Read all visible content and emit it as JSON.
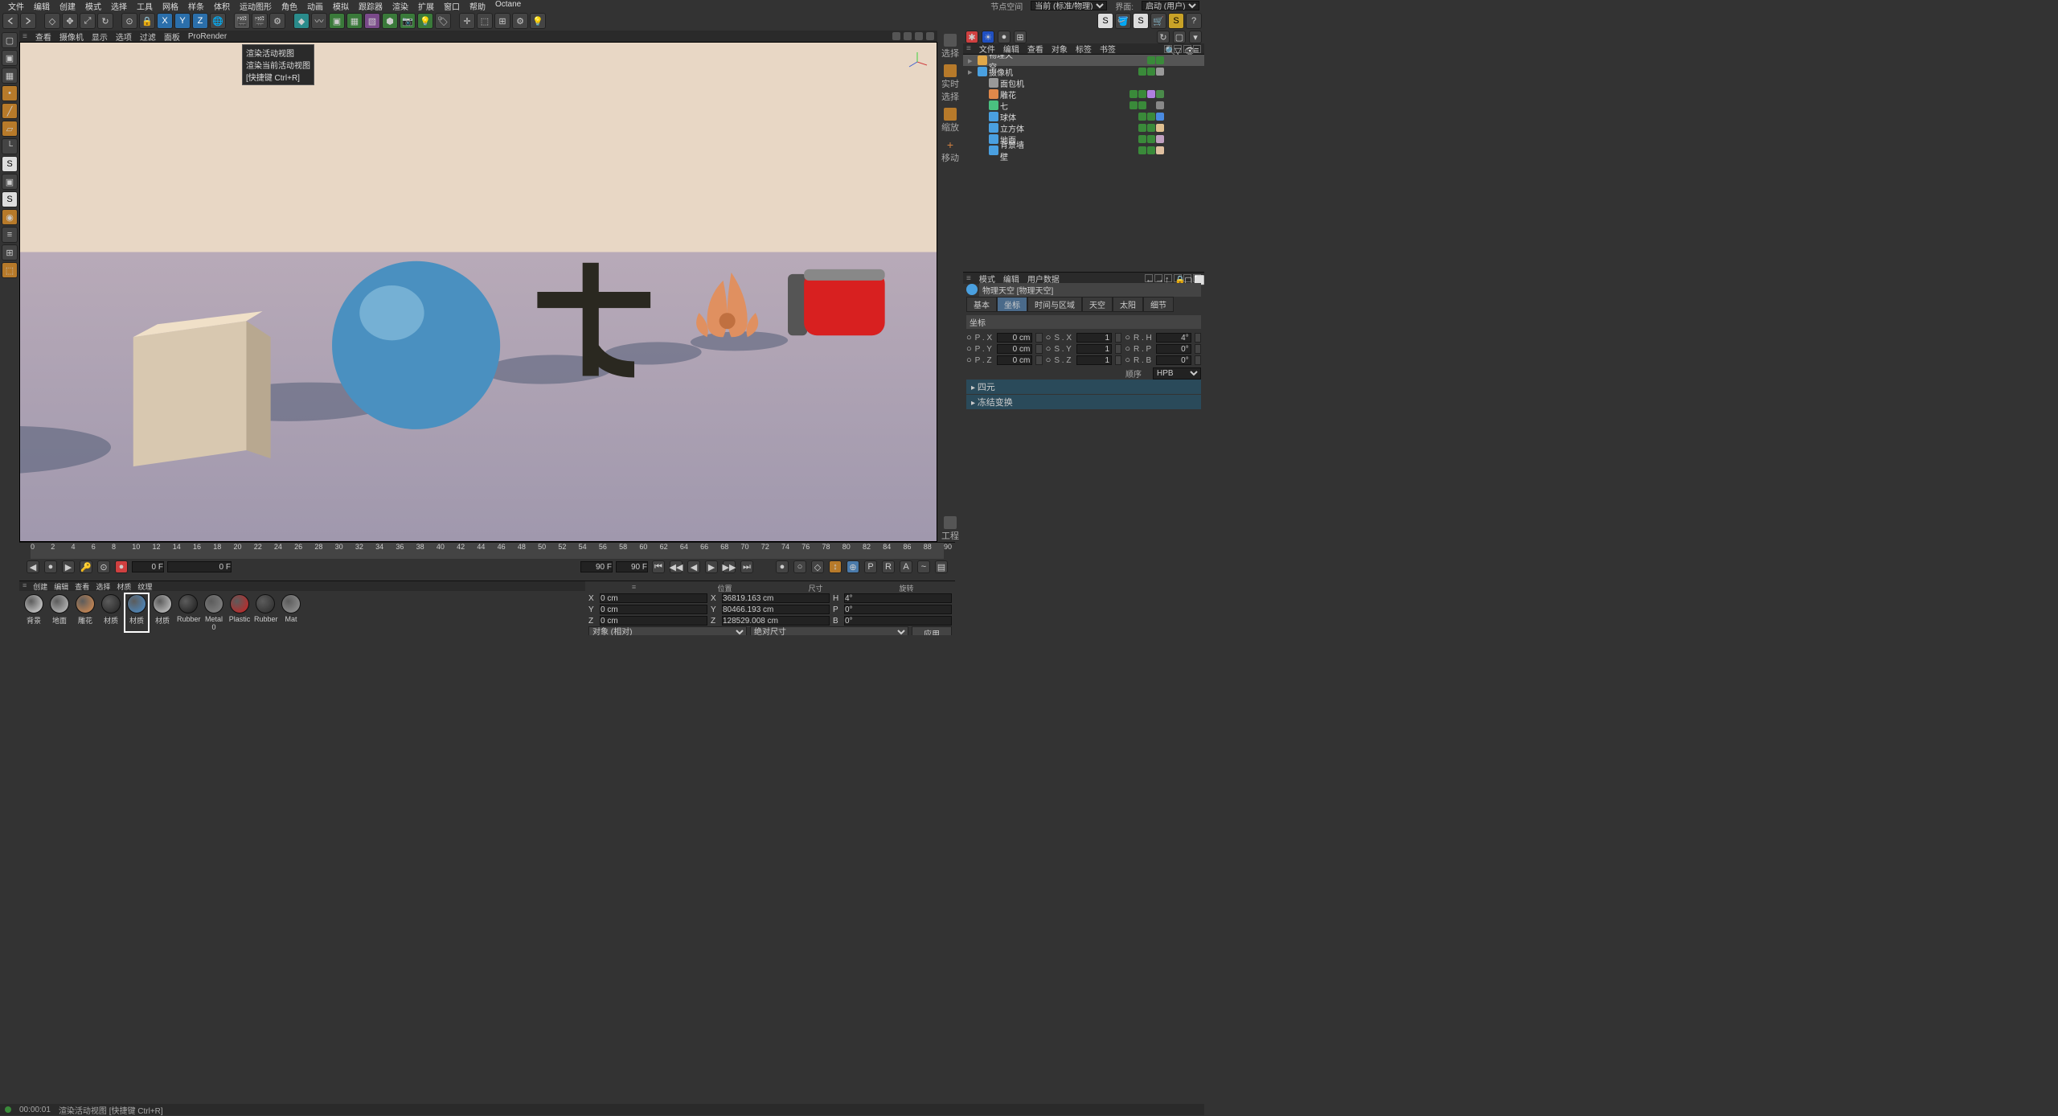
{
  "menu": {
    "items": [
      "文件",
      "编辑",
      "创建",
      "模式",
      "选择",
      "工具",
      "网格",
      "样条",
      "体积",
      "运动图形",
      "角色",
      "动画",
      "模拟",
      "跟踪器",
      "渲染",
      "扩展",
      "窗口",
      "帮助",
      "Octane"
    ],
    "right": {
      "pivot": "节点空间",
      "layout_label": "当前 (标准/物理)",
      "workspace_label": "界面:",
      "workspace": "启动 (用户)"
    }
  },
  "vp_menu": [
    "查看",
    "摄像机",
    "显示",
    "选项",
    "过滤",
    "面板",
    "ProRender"
  ],
  "tooltip": {
    "title": "渲染活动视图",
    "desc": "渲染当前活动视图",
    "shortcut": "[快捷键 Ctrl+R]"
  },
  "palette": [
    {
      "label": "选择"
    },
    {
      "label": "实时选择"
    },
    {
      "label": "缩放"
    },
    {
      "label": "移动"
    },
    {
      "label": ""
    },
    {
      "label": ""
    },
    {
      "label": "工程"
    }
  ],
  "obj_panel_tabs": [
    "文件",
    "编辑",
    "查看",
    "对象",
    "标签",
    "书签"
  ],
  "objects": [
    {
      "name": "物理天空",
      "indent": 0,
      "color": "#e0a84a",
      "sel": true,
      "tags": [
        "#3a8a3a",
        "#3a8a3a"
      ]
    },
    {
      "name": "摄像机",
      "indent": 0,
      "color": "#4aa0e0",
      "tags": [
        "#3a8a3a",
        "#3a8a3a",
        "#999"
      ]
    },
    {
      "name": "面包机",
      "indent": 1,
      "color": "#999",
      "tags": []
    },
    {
      "name": "雕花",
      "indent": 1,
      "color": "#e0884a",
      "tags": [
        "#3a8a3a",
        "#3a8a3a",
        "#b080e0",
        "#4a8a4a"
      ]
    },
    {
      "name": "七",
      "indent": 1,
      "color": "#4ac080",
      "tags": [
        "#3a8a3a",
        "#3a8a3a",
        "#333",
        "#888"
      ]
    },
    {
      "name": "球体",
      "indent": 1,
      "color": "#4aa0e0",
      "tags": [
        "#3a8a3a",
        "#3a8a3a",
        "#4a8ae0"
      ]
    },
    {
      "name": "立方体",
      "indent": 1,
      "color": "#4aa0e0",
      "tags": [
        "#3a8a3a",
        "#3a8a3a",
        "#e0c090"
      ]
    },
    {
      "name": "地面",
      "indent": 1,
      "color": "#4aa0e0",
      "tags": [
        "#3a8a3a",
        "#3a8a3a",
        "#c0a0c0"
      ]
    },
    {
      "name": "背景墙壁",
      "indent": 1,
      "color": "#4aa0e0",
      "tags": [
        "#3a8a3a",
        "#3a8a3a",
        "#e0c0a0"
      ]
    }
  ],
  "attr": {
    "header": [
      "模式",
      "编辑",
      "用户数据"
    ],
    "title": "物理天空 [物理天空]",
    "tabs": [
      "基本",
      "坐标",
      "时间与区域",
      "天空",
      "太阳",
      "细节"
    ],
    "active_tab": 1,
    "section": "坐标",
    "rows": [
      {
        "pl": "P . X",
        "pv": "0 cm",
        "sl": "S . X",
        "sv": "1",
        "rl": "R . H",
        "rv": "4°"
      },
      {
        "pl": "P . Y",
        "pv": "0 cm",
        "sl": "S . Y",
        "sv": "1",
        "rl": "R . P",
        "rv": "0°"
      },
      {
        "pl": "P . Z",
        "pv": "0 cm",
        "sl": "S . Z",
        "sv": "1",
        "rl": "R . B",
        "rv": "0°"
      }
    ],
    "order_label": "顺序",
    "order": "HPB",
    "sections": [
      "四元",
      "冻结变换"
    ]
  },
  "timeline": {
    "ticks": [
      0,
      2,
      4,
      6,
      8,
      10,
      12,
      14,
      16,
      18,
      20,
      22,
      24,
      26,
      28,
      30,
      32,
      34,
      36,
      38,
      40,
      42,
      44,
      46,
      48,
      50,
      52,
      54,
      56,
      58,
      60,
      62,
      64,
      66,
      68,
      70,
      72,
      74,
      76,
      78,
      80,
      82,
      84,
      86,
      88,
      90
    ],
    "cur": "0 F",
    "start": "0 F",
    "end1": "90 F",
    "end2": "90 F",
    "label_end": "0 F"
  },
  "mat_tabs": [
    "创建",
    "编辑",
    "查看",
    "选择",
    "材质",
    "纹理"
  ],
  "materials": [
    {
      "name": "背景",
      "color": "#e0e0e0"
    },
    {
      "name": "地面",
      "color": "#c8c8c8"
    },
    {
      "name": "雕花",
      "color": "#e09050"
    },
    {
      "name": "材质",
      "color": "#222"
    },
    {
      "name": "材质",
      "color": "#4a90d0",
      "sel": true
    },
    {
      "name": "材质",
      "color": "#d0d0d0"
    },
    {
      "name": "Rubber",
      "color": "#1a1a1a"
    },
    {
      "name": "Metal 0",
      "color": "#888"
    },
    {
      "name": "Plastic",
      "color": "#d02020"
    },
    {
      "name": "Rubber",
      "color": "#2a2a2a"
    },
    {
      "name": "Mat",
      "color": "#999"
    }
  ],
  "coord": {
    "hdrs": [
      "位置",
      "尺寸",
      "旋转"
    ],
    "rows": [
      {
        "a": "X",
        "p": "0 cm",
        "s": "X",
        "sv": "36819.163 cm",
        "r": "H",
        "rv": "4°"
      },
      {
        "a": "Y",
        "p": "0 cm",
        "s": "Y",
        "sv": "80466.193 cm",
        "r": "P",
        "rv": "0°"
      },
      {
        "a": "Z",
        "p": "0 cm",
        "s": "Z",
        "sv": "128529.008 cm",
        "r": "B",
        "rv": "0°"
      }
    ],
    "mode1": "对象 (相对)",
    "mode2": "绝对尺寸",
    "apply": "应用"
  },
  "status": {
    "time": "00:00:01",
    "msg": "渲染活动视图 [快捷键 Ctrl+R]"
  }
}
